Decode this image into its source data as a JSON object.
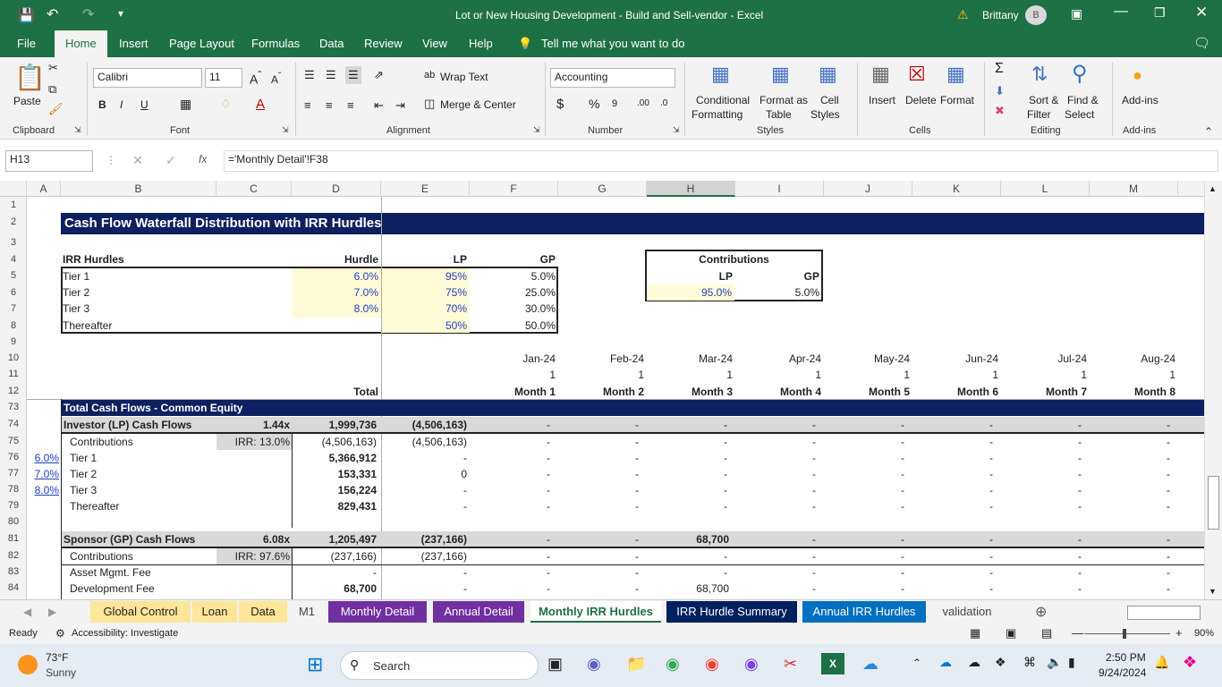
{
  "window": {
    "title": "Lot or New Housing Development - Build and Sell-vendor  -  Excel",
    "user": "Brittany",
    "user_initial": "B"
  },
  "menu": [
    "File",
    "Home",
    "Insert",
    "Page Layout",
    "Formulas",
    "Data",
    "Review",
    "View",
    "Help"
  ],
  "tell_me": "Tell me what you want to do",
  "ribbon": {
    "paste": "Paste",
    "font_name": "Calibri",
    "font_size": "11",
    "wrap_text": "Wrap Text",
    "merge_center": "Merge & Center",
    "number_format": "Accounting",
    "cond_fmt": "Conditional",
    "cond_fmt2": "Formatting",
    "format_table": "Format as",
    "format_table2": "Table",
    "cell_styles": "Cell",
    "cell_styles2": "Styles",
    "insert": "Insert",
    "delete": "Delete",
    "format": "Format",
    "sort": "Sort &",
    "sort2": "Filter",
    "find": "Find &",
    "find2": "Select",
    "addins": "Add-ins",
    "groups": {
      "clipboard": "Clipboard",
      "font": "Font",
      "alignment": "Alignment",
      "number": "Number",
      "styles": "Styles",
      "cells": "Cells",
      "editing": "Editing",
      "addins": "Add-ins"
    }
  },
  "formula_bar": {
    "name_box": "H13",
    "fx": "fx",
    "formula": "='Monthly Detail'!F38"
  },
  "columns": [
    "A",
    "B",
    "C",
    "D",
    "E",
    "F",
    "G",
    "H",
    "I",
    "J",
    "K",
    "L",
    "M"
  ],
  "rows": [
    "1",
    "2",
    "3",
    "4",
    "5",
    "6",
    "7",
    "8",
    "9",
    "10",
    "11",
    "12",
    "73",
    "74",
    "75",
    "76",
    "77",
    "78",
    "79",
    "80",
    "81",
    "82",
    "83",
    "84"
  ],
  "sheet": {
    "title": "Cash Flow Waterfall Distribution with IRR Hurdles",
    "hurdles_header": {
      "label": "IRR Hurdles",
      "hurdle": "Hurdle",
      "lp": "LP",
      "gp": "GP"
    },
    "hurdles": [
      {
        "tier": "Tier 1",
        "hurdle": "6.0%",
        "lp": "95%",
        "gp": "5.0%"
      },
      {
        "tier": "Tier 2",
        "hurdle": "7.0%",
        "lp": "75%",
        "gp": "25.0%"
      },
      {
        "tier": "Tier 3",
        "hurdle": "8.0%",
        "lp": "70%",
        "gp": "30.0%"
      },
      {
        "tier": "Thereafter",
        "hurdle": "",
        "lp": "50%",
        "gp": "50.0%"
      }
    ],
    "contributions": {
      "title": "Contributions",
      "lp_label": "LP",
      "gp_label": "GP",
      "lp": "95.0%",
      "gp": "5.0%"
    },
    "months": [
      "Jan-24",
      "Feb-24",
      "Mar-24",
      "Apr-24",
      "May-24",
      "Jun-24",
      "Jul-24",
      "Aug-24"
    ],
    "flags": [
      "1",
      "1",
      "1",
      "1",
      "1",
      "1",
      "1",
      "1"
    ],
    "month_labels": [
      "Month 1",
      "Month 2",
      "Month 3",
      "Month 4",
      "Month 5",
      "Month 6",
      "Month 7",
      "Month 8"
    ],
    "total_label": "Total",
    "section_title": "Total Cash Flows - Common Equity",
    "lp": {
      "label": "Investor (LP) Cash Flows",
      "multiple": "1.44x",
      "total": "1,999,736",
      "e": "(4,506,163)",
      "months": [
        "-",
        "-",
        "-",
        "-",
        "-",
        "-",
        "-",
        "-"
      ]
    },
    "lp_rows": [
      {
        "a": "",
        "label": "Contributions",
        "irr": "IRR: 13.0%",
        "total": "(4,506,163)",
        "e": "(4,506,163)",
        "months": [
          "-",
          "-",
          "-",
          "-",
          "-",
          "-",
          "-",
          "-"
        ]
      },
      {
        "a": "6.0%",
        "label": "Tier 1",
        "irr": "",
        "total": "5,366,912",
        "e": "-",
        "months": [
          "-",
          "-",
          "-",
          "-",
          "-",
          "-",
          "-",
          "-"
        ]
      },
      {
        "a": "7.0%",
        "label": "Tier 2",
        "irr": "",
        "total": "153,331",
        "e": "0",
        "months": [
          "-",
          "-",
          "-",
          "-",
          "-",
          "-",
          "-",
          "-"
        ]
      },
      {
        "a": "8.0%",
        "label": "Tier 3",
        "irr": "",
        "total": "156,224",
        "e": "-",
        "months": [
          "-",
          "-",
          "-",
          "-",
          "-",
          "-",
          "-",
          "-"
        ]
      },
      {
        "a": "",
        "label": "Thereafter",
        "irr": "",
        "total": "829,431",
        "e": "-",
        "months": [
          "-",
          "-",
          "-",
          "-",
          "-",
          "-",
          "-",
          "-"
        ]
      }
    ],
    "gp": {
      "label": "Sponsor (GP) Cash Flows",
      "multiple": "6.08x",
      "total": "1,205,497",
      "e": "(237,166)",
      "months": [
        "-",
        "-",
        "68,700",
        "-",
        "-",
        "-",
        "-",
        "-"
      ]
    },
    "gp_rows": [
      {
        "label": "Contributions",
        "irr": "IRR: 97.6%",
        "total": "(237,166)",
        "e": "(237,166)",
        "months": [
          "-",
          "-",
          "-",
          "-",
          "-",
          "-",
          "-",
          "-"
        ]
      },
      {
        "label": "Asset Mgmt. Fee",
        "irr": "",
        "total": "-",
        "e": "-",
        "months": [
          "-",
          "-",
          "-",
          "-",
          "-",
          "-",
          "-",
          "-"
        ]
      },
      {
        "label": "Development Fee",
        "irr": "",
        "total": "68,700",
        "e": "-",
        "months": [
          "-",
          "-",
          "68,700",
          "-",
          "-",
          "-",
          "-",
          "-"
        ]
      }
    ]
  },
  "tabs": [
    {
      "name": "Global Control",
      "bg": "#ffe699",
      "fg": "#222"
    },
    {
      "name": "Loan",
      "bg": "#ffe699",
      "fg": "#222"
    },
    {
      "name": "Data",
      "bg": "#ffe699",
      "fg": "#222"
    },
    {
      "name": "M1",
      "bg": "#f3f3f3",
      "fg": "#444"
    },
    {
      "name": "Monthly Detail",
      "bg": "#7030a0",
      "fg": "#fff"
    },
    {
      "name": "Annual Detail",
      "bg": "#7030a0",
      "fg": "#fff"
    },
    {
      "name": "Monthly IRR Hurdles",
      "bg": "#ffffff",
      "fg": "#1e7145"
    },
    {
      "name": "IRR Hurdle Summary",
      "bg": "#002060",
      "fg": "#fff"
    },
    {
      "name": "Annual IRR Hurdles",
      "bg": "#0070c0",
      "fg": "#fff"
    },
    {
      "name": "validation",
      "bg": "#f3f3f3",
      "fg": "#444"
    }
  ],
  "status": {
    "ready": "Ready",
    "accessibility": "Accessibility: Investigate",
    "zoom": "90%"
  },
  "taskbar": {
    "temp": "73°F",
    "weather": "Sunny",
    "search": "Search",
    "time": "2:50 PM",
    "date": "9/24/2024"
  }
}
